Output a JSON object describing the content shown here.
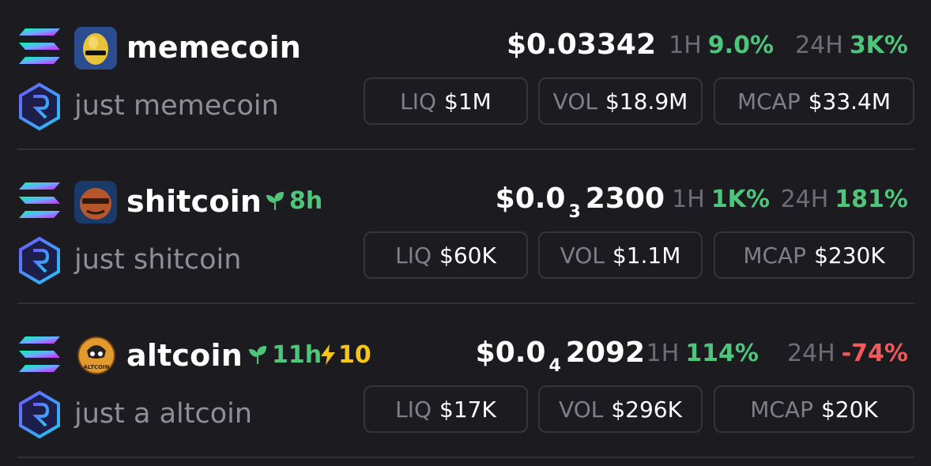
{
  "colors": {
    "background": "#1c1b20",
    "positive": "#4fc57c",
    "negative": "#f05a5a",
    "boost": "#f5c518",
    "muted_text": "#8f8e96",
    "divider": "#313036"
  },
  "tokens": [
    {
      "chain_icon": "solana-icon",
      "dex_icon": "raydium-icon",
      "avatar_icon": "memecoin-avatar",
      "name": "memecoin",
      "description": "just memecoin",
      "age": "",
      "boost": "",
      "price": "$0.03342",
      "price_subscript": "",
      "price_tail": "",
      "change_1h_label": "1H",
      "change_1h": "9.0%",
      "change_24h_label": "24H",
      "change_24h": "3K%",
      "liq_label": "LIQ",
      "liq": "$1M",
      "vol_label": "VOL",
      "vol": "$18.9M",
      "mcap_label": "MCAP",
      "mcap": "$33.4M"
    },
    {
      "chain_icon": "solana-icon",
      "dex_icon": "raydium-icon",
      "avatar_icon": "shitcoin-avatar",
      "name": "shitcoin",
      "description": "just shitcoin",
      "age": "8h",
      "boost": "",
      "price": "$0.0",
      "price_subscript": "3",
      "price_tail": "2300",
      "change_1h_label": "1H",
      "change_1h": "1K%",
      "change_24h_label": "24H",
      "change_24h": "181%",
      "liq_label": "LIQ",
      "liq": "$60K",
      "vol_label": "VOL",
      "vol": "$1.1M",
      "mcap_label": "MCAP",
      "mcap": "$230K"
    },
    {
      "chain_icon": "solana-icon",
      "dex_icon": "raydium-icon",
      "avatar_icon": "altcoin-avatar",
      "avatar_text": "ALTCOIN",
      "name": "altcoin",
      "description": "just a altcoin",
      "age": "11h",
      "boost": "10",
      "price": "$0.0",
      "price_subscript": "4",
      "price_tail": "2092",
      "change_1h_label": "1H",
      "change_1h": "114%",
      "change_24h_label": "24H",
      "change_24h": "-74%",
      "liq_label": "LIQ",
      "liq": "$17K",
      "vol_label": "VOL",
      "vol": "$296K",
      "mcap_label": "MCAP",
      "mcap": "$20K"
    }
  ]
}
